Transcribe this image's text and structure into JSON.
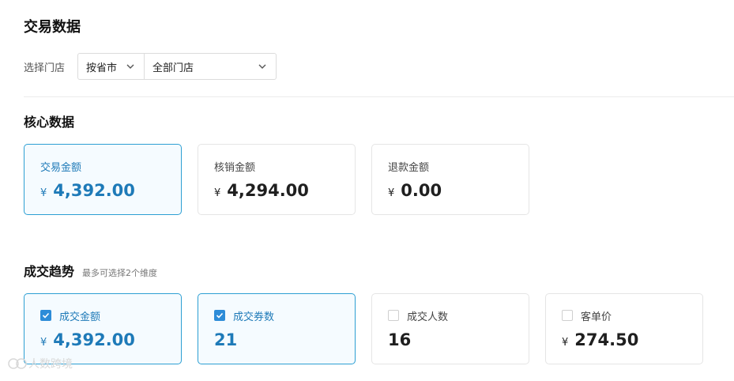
{
  "page": {
    "title": "交易数据"
  },
  "filter": {
    "label": "选择门店",
    "province_select": "按省市",
    "store_select": "全部门店"
  },
  "core": {
    "title": "核心数据",
    "cards": [
      {
        "label": "交易金额",
        "currency": "¥",
        "value": "4,392.00",
        "active": true
      },
      {
        "label": "核销金额",
        "currency": "¥",
        "value": "4,294.00",
        "active": false
      },
      {
        "label": "退款金额",
        "currency": "¥",
        "value": "0.00",
        "active": false
      }
    ]
  },
  "trend": {
    "title": "成交趋势",
    "hint": "最多可选择2个维度",
    "cards": [
      {
        "label": "成交金额",
        "currency": "¥",
        "value": "4,392.00",
        "checked": true
      },
      {
        "label": "成交券数",
        "currency": "",
        "value": "21",
        "checked": true
      },
      {
        "label": "成交人数",
        "currency": "",
        "value": "16",
        "checked": false
      },
      {
        "label": "客单价",
        "currency": "¥",
        "value": "274.50",
        "checked": false
      }
    ]
  },
  "watermark": {
    "text": "人数跨境"
  },
  "colors": {
    "accent": "#2d9fd3",
    "checkbox": "#2d8cd8",
    "active_text": "#1e7ab8"
  }
}
